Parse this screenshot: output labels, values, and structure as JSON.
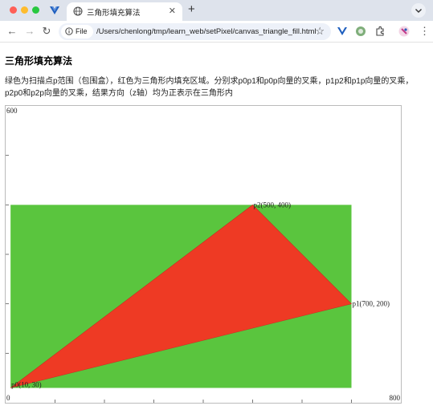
{
  "browser": {
    "tab_title": "三角形填充算法",
    "file_chip": "File",
    "url": "/Users/chenlong/tmp/learn_web/setPixel/canvas_triangle_fill.html"
  },
  "page": {
    "title": "三角形填充算法",
    "description": "绿色为扫描点p范围（包围盒），红色为三角形内填充区域。分别求p0p1和p0p向量的叉乘，p1p2和p1p向量的叉乘，p2p0和p2p向量的叉乘，结果方向（z轴）均为正表示在三角形内"
  },
  "colors": {
    "bbox_fill": "#5ac53e",
    "triangle_fill": "#ee3a24"
  },
  "chart_data": {
    "type": "scatter",
    "xlim": [
      0,
      800
    ],
    "ylim": [
      0,
      600
    ],
    "corner_labels": {
      "x_min": "0",
      "x_max": "800",
      "y_max": "600"
    },
    "bounding_box": {
      "x_min": 10,
      "x_max": 700,
      "y_min": 30,
      "y_max": 400
    },
    "points": [
      {
        "x": 10,
        "y": 30,
        "label": "p0(10, 30)"
      },
      {
        "x": 700,
        "y": 200,
        "label": "p1(700, 200)"
      },
      {
        "x": 500,
        "y": 400,
        "label": "p2(500, 400)"
      }
    ]
  }
}
